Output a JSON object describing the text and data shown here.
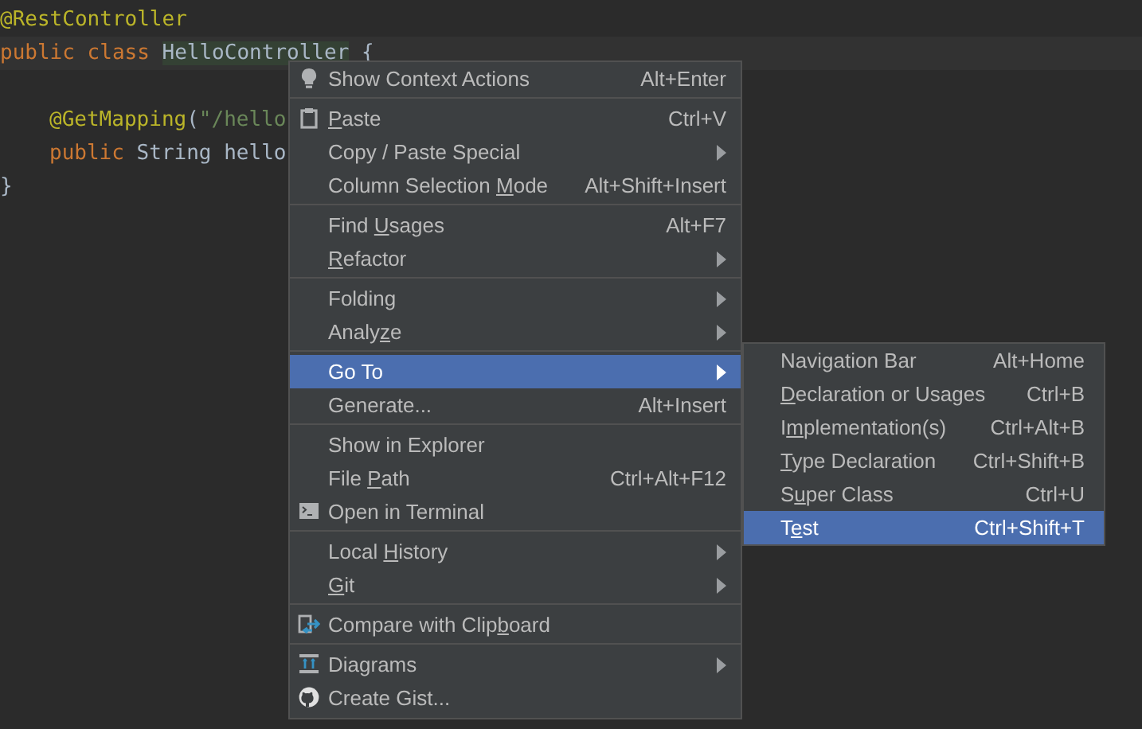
{
  "editor": {
    "lines": [
      {
        "kind": "code",
        "indented": false,
        "tokens": [
          {
            "text": "@RestController",
            "kind": "annotation",
            "highlighted": false
          }
        ]
      },
      {
        "kind": "code",
        "current": true,
        "indented": false,
        "tokens": [
          {
            "text": "public class ",
            "kind": "keyword",
            "highlighted": false
          },
          {
            "text": "HelloController",
            "kind": "plain",
            "highlighted": true
          },
          {
            "text": " {",
            "kind": "plain",
            "highlighted": false
          }
        ]
      },
      {
        "kind": "blank"
      },
      {
        "kind": "code",
        "indented": true,
        "tokens": [
          {
            "text": "@GetMapping",
            "kind": "annotation",
            "highlighted": false
          },
          {
            "text": "(",
            "kind": "plain",
            "highlighted": false
          },
          {
            "text": "\"/hello",
            "kind": "string",
            "highlighted": false
          }
        ]
      },
      {
        "kind": "code",
        "indented": true,
        "tokens": [
          {
            "text": "public ",
            "kind": "keyword",
            "highlighted": false
          },
          {
            "text": "String ",
            "kind": "plain",
            "highlighted": false
          },
          {
            "text": "hello",
            "kind": "plain",
            "highlighted": false
          }
        ]
      },
      {
        "kind": "code",
        "indented": false,
        "tokens": [
          {
            "text": "}",
            "kind": "plain",
            "highlighted": false
          }
        ]
      }
    ]
  },
  "context_menu": {
    "groups": [
      [
        {
          "kind": "lightbulb",
          "label": "Show Context Actions",
          "shortcut": "Alt+Enter",
          "submenu": false,
          "selected": false
        }
      ],
      [
        {
          "kind": "clipboard",
          "mnemonic": "P",
          "after": "aste",
          "shortcut": "Ctrl+V",
          "submenu": false,
          "selected": false
        },
        {
          "kind": "plain",
          "label": "Copy / Paste Special",
          "submenu": true,
          "selected": false
        },
        {
          "kind": "plain",
          "before": "Column Selection ",
          "mnemonic": "M",
          "after": "ode",
          "shortcut": "Alt+Shift+Insert",
          "submenu": false,
          "selected": false
        }
      ],
      [
        {
          "kind": "plain",
          "before": "Find ",
          "mnemonic": "U",
          "after": "sages",
          "shortcut": "Alt+F7",
          "submenu": false,
          "selected": false
        },
        {
          "kind": "plain",
          "mnemonic": "R",
          "after": "efactor",
          "submenu": true,
          "selected": false
        }
      ],
      [
        {
          "kind": "plain",
          "label": "Folding",
          "submenu": true,
          "selected": false
        },
        {
          "kind": "plain",
          "before": "Analy",
          "mnemonic": "z",
          "after": "e",
          "submenu": true,
          "selected": false
        }
      ],
      [
        {
          "kind": "plain",
          "label": "Go To",
          "submenu": true,
          "selected": true
        },
        {
          "kind": "plain",
          "label": "Generate...",
          "shortcut": "Alt+Insert",
          "submenu": false,
          "selected": false
        }
      ],
      [
        {
          "kind": "plain",
          "label": "Show in Explorer",
          "submenu": false,
          "selected": false
        },
        {
          "kind": "plain",
          "before": "File ",
          "mnemonic": "P",
          "after": "ath",
          "shortcut": "Ctrl+Alt+F12",
          "submenu": false,
          "selected": false
        },
        {
          "kind": "terminal",
          "label": "Open in Terminal",
          "submenu": false,
          "selected": false
        }
      ],
      [
        {
          "kind": "plain",
          "before": "Local ",
          "mnemonic": "H",
          "after": "istory",
          "submenu": true,
          "selected": false
        },
        {
          "kind": "plain",
          "mnemonic": "G",
          "after": "it",
          "submenu": true,
          "selected": false
        }
      ],
      [
        {
          "kind": "compare",
          "before": "Compare with Clip",
          "mnemonic": "b",
          "after": "oard",
          "submenu": false,
          "selected": false
        }
      ],
      [
        {
          "kind": "diagram",
          "label": "Diagrams",
          "submenu": true,
          "selected": false
        },
        {
          "kind": "github",
          "label": "Create Gist...",
          "submenu": false,
          "selected": false
        }
      ]
    ]
  },
  "submenu": {
    "items": [
      {
        "label": "Navigation Bar",
        "shortcut": "Alt+Home",
        "selected": false
      },
      {
        "mnemonic": "D",
        "after": "eclaration or Usages",
        "shortcut": "Ctrl+B",
        "selected": false
      },
      {
        "before": "I",
        "mnemonic": "m",
        "after": "plementation(s)",
        "shortcut": "Ctrl+Alt+B",
        "selected": false
      },
      {
        "mnemonic": "T",
        "after": "ype Declaration",
        "shortcut": "Ctrl+Shift+B",
        "selected": false
      },
      {
        "before": "S",
        "mnemonic": "u",
        "after": "per Class",
        "shortcut": "Ctrl+U",
        "selected": false
      },
      {
        "before": "T",
        "mnemonic": "e",
        "after": "st",
        "shortcut": "Ctrl+Shift+T",
        "selected": true
      }
    ]
  }
}
